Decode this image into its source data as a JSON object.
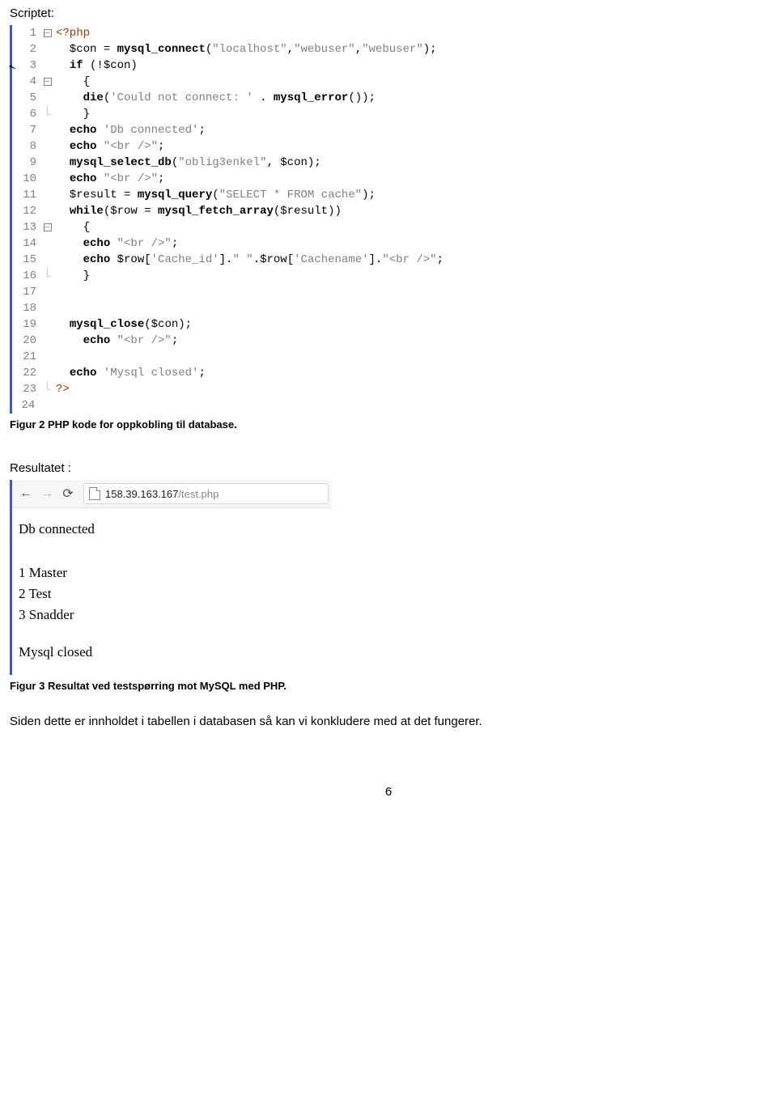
{
  "headings": {
    "scriptet": "Scriptet:",
    "resultatet": "Resultatet :"
  },
  "captions": {
    "fig2": "Figur 2 PHP kode for oppkobling til database.",
    "fig3": "Figur 3 Resultat ved testspørring mot MySQL med PHP."
  },
  "body_text": "Siden dette er innholdet i tabellen i databasen så kan vi konkludere med at det fungerer.",
  "page_number": "6",
  "code": {
    "lines": [
      {
        "n": "1",
        "fold": "box",
        "html": "<span class='tag'>&lt;?php</span>"
      },
      {
        "n": "2",
        "fold": "bar",
        "html": "  $con = <span class='fn'>mysql_connect</span>(<span class='str'>\"localhost\"</span>,<span class='str'>\"webuser\"</span>,<span class='str'>\"webuser\"</span>);"
      },
      {
        "n": "3",
        "fold": "bar",
        "html": "  <span class='kw'>if</span> (!$con)"
      },
      {
        "n": "4",
        "fold": "box",
        "html": "    {"
      },
      {
        "n": "5",
        "fold": "bar",
        "html": "    <span class='kw'>die</span>(<span class='str'>'Could not connect: '</span> . <span class='fn'>mysql_error</span>());"
      },
      {
        "n": "6",
        "fold": "end",
        "html": "    }"
      },
      {
        "n": "7",
        "fold": "bar",
        "html": "  <span class='kw'>echo</span> <span class='str'>'Db connected'</span>;"
      },
      {
        "n": "8",
        "fold": "bar",
        "html": "  <span class='kw'>echo</span> <span class='str'>\"&lt;br /&gt;\"</span>;"
      },
      {
        "n": "9",
        "fold": "bar",
        "html": "  <span class='fn'>mysql_select_db</span>(<span class='str'>\"oblig3enkel\"</span>, $con);"
      },
      {
        "n": "10",
        "fold": "bar",
        "html": "  <span class='kw'>echo</span> <span class='str'>\"&lt;br /&gt;\"</span>;"
      },
      {
        "n": "11",
        "fold": "bar",
        "html": "  $result = <span class='fn'>mysql_query</span>(<span class='str'>\"SELECT * FROM cache\"</span>);"
      },
      {
        "n": "12",
        "fold": "bar",
        "html": "  <span class='kw'>while</span>($row = <span class='fn'>mysql_fetch_array</span>($result))"
      },
      {
        "n": "13",
        "fold": "box",
        "html": "    {"
      },
      {
        "n": "14",
        "fold": "bar",
        "html": "    <span class='kw'>echo</span> <span class='str'>\"&lt;br /&gt;\"</span>;"
      },
      {
        "n": "15",
        "fold": "bar",
        "html": "    <span class='kw'>echo</span> $row[<span class='str'>'Cache_id'</span>].<span class='str'>\" \"</span>.$row[<span class='str'>'Cachename'</span>].<span class='str'>\"&lt;br /&gt;\"</span>;"
      },
      {
        "n": "16",
        "fold": "end",
        "html": "    }"
      },
      {
        "n": "17",
        "fold": "bar",
        "html": ""
      },
      {
        "n": "18",
        "fold": "bar",
        "html": ""
      },
      {
        "n": "19",
        "fold": "bar",
        "html": "  <span class='fn'>mysql_close</span>($con);"
      },
      {
        "n": "20",
        "fold": "bar",
        "html": "    <span class='kw'>echo</span> <span class='str'>\"&lt;br /&gt;\"</span>;"
      },
      {
        "n": "21",
        "fold": "bar",
        "html": ""
      },
      {
        "n": "22",
        "fold": "bar",
        "html": "  <span class='kw'>echo</span> <span class='str'>'Mysql closed'</span>;"
      },
      {
        "n": "23",
        "fold": "end",
        "html": "<span class='tag'>?&gt;</span>"
      },
      {
        "n": "24",
        "fold": "",
        "html": ""
      }
    ]
  },
  "browser": {
    "url_host": "158.39.163.167",
    "url_path": "/test.php",
    "output": {
      "connected": "Db connected",
      "rows": [
        "1 Master",
        "2 Test",
        "3 Snadder"
      ],
      "closed": "Mysql closed"
    }
  }
}
